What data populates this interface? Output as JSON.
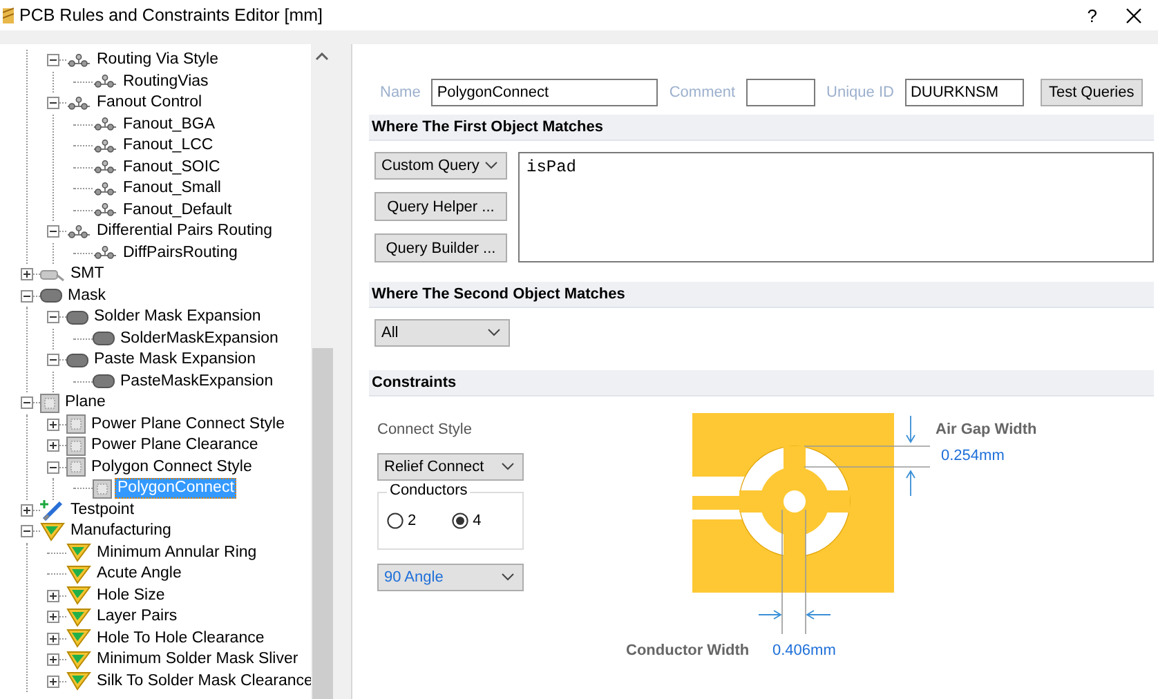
{
  "window": {
    "title": "PCB Rules and Constraints Editor [mm]",
    "help": "?"
  },
  "tree": {
    "items": [
      {
        "children": [
          {
            "label": "Routing Via Style",
            "kind": "routing",
            "selected": false,
            "expanded": true,
            "children": [
              {
                "label": "RoutingVias",
                "kind": "routing",
                "selected": false
              }
            ]
          },
          {
            "label": "Fanout Control",
            "kind": "routing",
            "selected": false,
            "expanded": true,
            "children": [
              {
                "label": "Fanout_BGA",
                "kind": "routing",
                "selected": false
              },
              {
                "label": "Fanout_LCC",
                "kind": "routing",
                "selected": false
              },
              {
                "label": "Fanout_SOIC",
                "kind": "routing",
                "selected": false
              },
              {
                "label": "Fanout_Small",
                "kind": "routing",
                "selected": false
              },
              {
                "label": "Fanout_Default",
                "kind": "routing",
                "selected": false
              }
            ]
          },
          {
            "label": "Differential Pairs Routing",
            "kind": "routing",
            "selected": false,
            "expanded": true,
            "children": [
              {
                "label": "DiffPairsRouting",
                "kind": "routing",
                "selected": false
              }
            ]
          }
        ]
      },
      {
        "label": "SMT",
        "kind": "smt",
        "selected": false,
        "expanded": false
      },
      {
        "label": "Mask",
        "kind": "mask",
        "selected": false,
        "expanded": true,
        "children": [
          {
            "label": "Solder Mask Expansion",
            "kind": "mask",
            "selected": false,
            "expanded": true,
            "children": [
              {
                "label": "SolderMaskExpansion",
                "kind": "mask",
                "selected": false
              }
            ]
          },
          {
            "label": "Paste Mask Expansion",
            "kind": "mask",
            "selected": false,
            "expanded": true,
            "children": [
              {
                "label": "PasteMaskExpansion",
                "kind": "mask",
                "selected": false
              }
            ]
          }
        ]
      },
      {
        "label": "Plane",
        "kind": "plane",
        "selected": false,
        "expanded": true,
        "children": [
          {
            "label": "Power Plane Connect Style",
            "kind": "plane",
            "selected": false,
            "expanded": false
          },
          {
            "label": "Power Plane Clearance",
            "kind": "plane",
            "selected": false,
            "expanded": false
          },
          {
            "label": "Polygon Connect Style",
            "kind": "plane",
            "selected": false,
            "expanded": true,
            "children": [
              {
                "label": "PolygonConnect",
                "kind": "plane",
                "selected": true
              }
            ]
          }
        ]
      },
      {
        "label": "Testpoint",
        "kind": "testpoint",
        "selected": false,
        "expanded": false
      },
      {
        "label": "Manufacturing",
        "kind": "manufacturing",
        "selected": false,
        "expanded": true,
        "children": [
          {
            "label": "Minimum Annular Ring",
            "kind": "manufacturing",
            "selected": false
          },
          {
            "label": "Acute Angle",
            "kind": "manufacturing",
            "selected": false
          },
          {
            "label": "Hole Size",
            "kind": "manufacturing",
            "selected": false,
            "expanded": false
          },
          {
            "label": "Layer Pairs",
            "kind": "manufacturing",
            "selected": false,
            "expanded": false
          },
          {
            "label": "Hole To Hole Clearance",
            "kind": "manufacturing",
            "selected": false,
            "expanded": false
          },
          {
            "label": "Minimum Solder Mask Sliver",
            "kind": "manufacturing",
            "selected": false,
            "expanded": false
          },
          {
            "label": "Silk To Solder Mask Clearance",
            "kind": "manufacturing",
            "selected": false,
            "expanded": false
          }
        ]
      }
    ]
  },
  "rule": {
    "name_label": "Name",
    "name": "PolygonConnect",
    "comment_label": "Comment",
    "id_label": "Unique ID",
    "id": "DUURKNSM",
    "test_button": "Test Queries"
  },
  "first_object": {
    "title": "Where The First Object Matches",
    "query_type": "Custom Query",
    "helper_button": "Query Helper ...",
    "builder_button": "Query Builder ...",
    "query": "isPad"
  },
  "second_object": {
    "title": "Where The Second Object Matches",
    "query_type": "All"
  },
  "constraints": {
    "title": "Constraints",
    "connect_style_label": "Connect Style",
    "connect_style": "Relief Connect",
    "conductors_label": "Conductors",
    "conductors": [
      {
        "label": "2",
        "selected": false
      },
      {
        "label": "4",
        "selected": true
      }
    ],
    "angle": "90 Angle",
    "air_gap_label": "Air Gap Width",
    "air_gap": "0.254mm",
    "conductor_width_label": "Conductor Width",
    "conductor_width": "0.406mm"
  }
}
